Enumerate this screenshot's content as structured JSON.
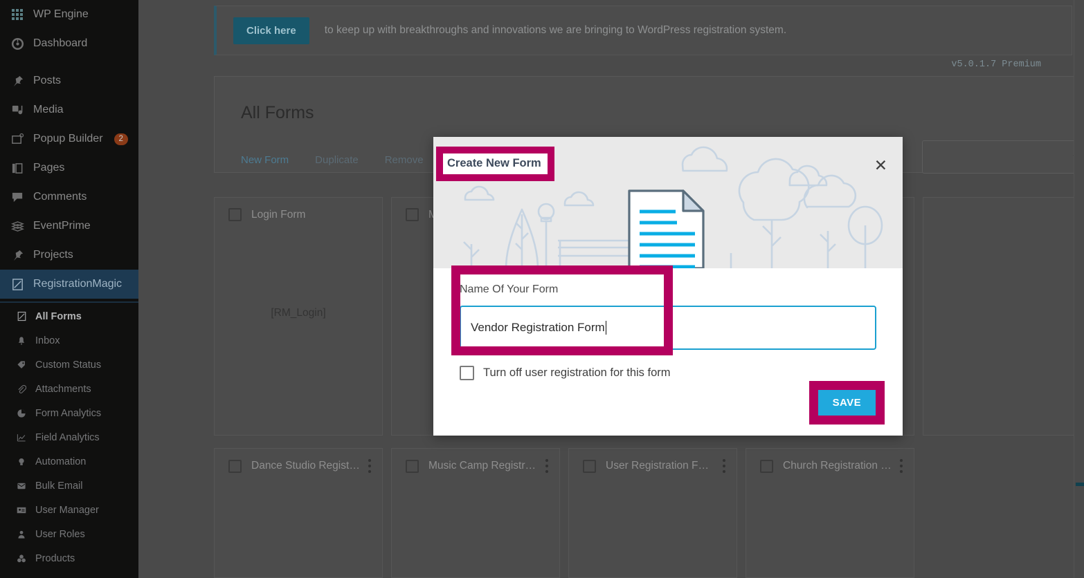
{
  "sidebar": {
    "top_items": [
      {
        "label": "WP Engine",
        "icon": "wpengine-icon"
      },
      {
        "label": "Dashboard",
        "icon": "dashboard-icon"
      }
    ],
    "items": [
      {
        "label": "Posts",
        "icon": "pin-icon",
        "badge": ""
      },
      {
        "label": "Media",
        "icon": "media-icon",
        "badge": ""
      },
      {
        "label": "Popup Builder",
        "icon": "popup-icon",
        "badge": "2"
      },
      {
        "label": "Pages",
        "icon": "pages-icon",
        "badge": ""
      },
      {
        "label": "Comments",
        "icon": "comments-icon",
        "badge": ""
      },
      {
        "label": "EventPrime",
        "icon": "eventprime-icon",
        "badge": ""
      },
      {
        "label": "Projects",
        "icon": "pin-icon",
        "badge": ""
      },
      {
        "label": "RegistrationMagic",
        "icon": "registrationmagic-icon",
        "badge": ""
      }
    ],
    "submenu": [
      {
        "label": "All Forms",
        "icon": "form-icon",
        "selected": true
      },
      {
        "label": "Inbox",
        "icon": "inbox-icon",
        "selected": false
      },
      {
        "label": "Custom Status",
        "icon": "tag-icon",
        "selected": false
      },
      {
        "label": "Attachments",
        "icon": "paperclip-icon",
        "selected": false
      },
      {
        "label": "Form Analytics",
        "icon": "pie-chart-icon",
        "selected": false
      },
      {
        "label": "Field Analytics",
        "icon": "line-chart-icon",
        "selected": false
      },
      {
        "label": "Automation",
        "icon": "lightbulb-icon",
        "selected": false
      },
      {
        "label": "Bulk Email",
        "icon": "envelope-icon",
        "selected": false
      },
      {
        "label": "User Manager",
        "icon": "id-card-icon",
        "selected": false
      },
      {
        "label": "User Roles",
        "icon": "user-icon",
        "selected": false
      },
      {
        "label": "Products",
        "icon": "products-icon",
        "selected": false
      }
    ]
  },
  "notice": {
    "button_label": "Click here",
    "text": "to keep up with breakthroughs and innovations we are bringing to WordPress registration system."
  },
  "version_label": "v5.0.1.7 Premium",
  "panel": {
    "title": "All Forms",
    "tabs": [
      {
        "label": "New Form",
        "active": true
      },
      {
        "label": "Duplicate",
        "active": false
      },
      {
        "label": "Remove",
        "active": false
      }
    ],
    "gear_icon": "gear-icon",
    "select_value": "",
    "select_chevron": "chevron-down-icon"
  },
  "cards_row1": [
    {
      "name": "Login Form",
      "shortcode": "[RM_Login]"
    },
    {
      "name": "Ma",
      "shortcode": "["
    }
  ],
  "cards_row2": [
    {
      "name": "Dance Studio Registra..."
    },
    {
      "name": "Music Camp Registrat..."
    },
    {
      "name": "User Registration Form"
    },
    {
      "name": "Church Registration F..."
    }
  ],
  "modal": {
    "title": "Create New Form",
    "close_icon": "close-icon",
    "field_label": "Name Of Your Form",
    "field_value": "Vendor Registration Form",
    "field_placeholder": "",
    "checkbox_label": "Turn off user registration for this form",
    "checkbox_checked": false,
    "save_label": "SAVE"
  },
  "colors": {
    "accent_magenta": "#b4005e",
    "accent_cyan": "#20a9dd",
    "sidebar_bg": "#10100f",
    "active_item": "#1d3a52",
    "badge": "#8a3a17"
  }
}
